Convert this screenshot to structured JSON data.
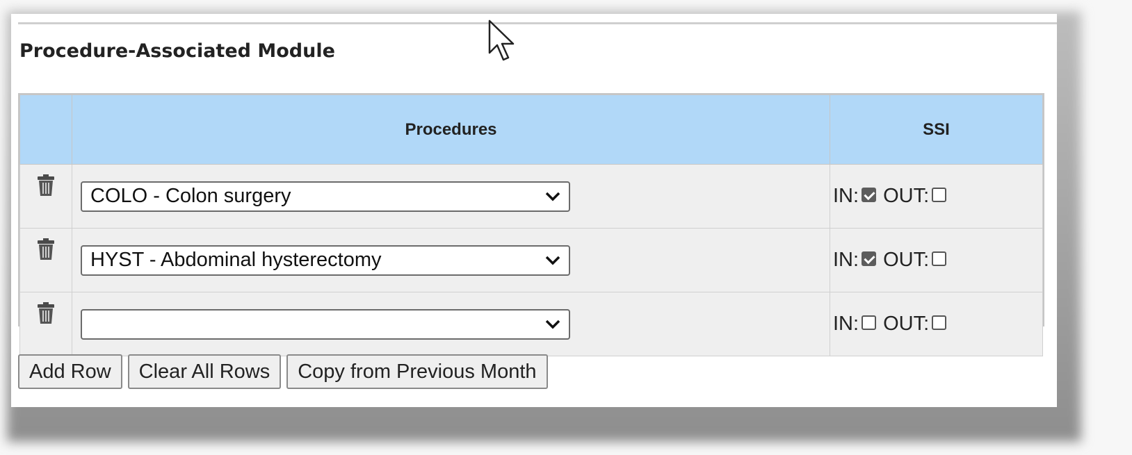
{
  "section": {
    "title": "Procedure-Associated Module"
  },
  "table": {
    "headers": {
      "procedures": "Procedures",
      "ssi": "SSI"
    },
    "rows": [
      {
        "procedure": "COLO - Colon surgery",
        "in_label": "IN:",
        "in_checked": true,
        "out_label": "OUT:",
        "out_checked": false
      },
      {
        "procedure": "HYST - Abdominal hysterectomy",
        "in_label": "IN:",
        "in_checked": true,
        "out_label": "OUT:",
        "out_checked": false
      },
      {
        "procedure": "",
        "in_label": "IN:",
        "in_checked": false,
        "out_label": "OUT:",
        "out_checked": false
      }
    ]
  },
  "buttons": {
    "add_row": "Add Row",
    "clear_all": "Clear All Rows",
    "copy_prev": "Copy from Previous Month"
  },
  "icons": {
    "delete": "trash-icon",
    "dropdown": "chevron-down-icon",
    "pointer": "mouse-cursor-icon"
  },
  "colors": {
    "header_bg": "#b1d8f8",
    "row_bg": "#efefef",
    "checkbox_checked": "#5c5c5c"
  }
}
